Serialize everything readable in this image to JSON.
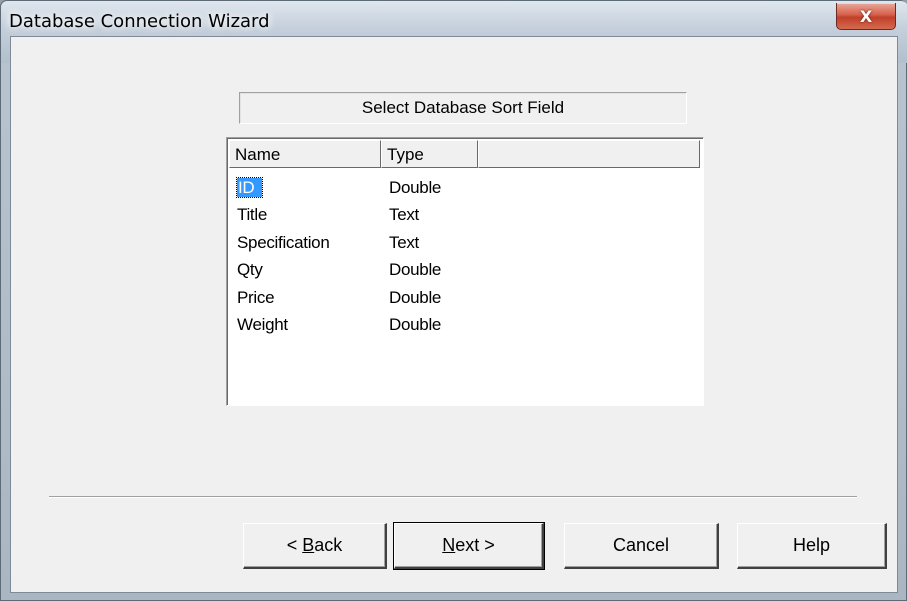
{
  "window": {
    "title": "Database Connection Wizard",
    "close_symbol": "X",
    "close_icon": "close-icon"
  },
  "panel": {
    "heading": "Select Database Sort Field"
  },
  "fields_list": {
    "columns": [
      "Name",
      "Type",
      ""
    ],
    "rows": [
      {
        "name": "ID",
        "type": "Double",
        "selected": true
      },
      {
        "name": "Title",
        "type": "Text",
        "selected": false
      },
      {
        "name": "Specification",
        "type": "Text",
        "selected": false
      },
      {
        "name": "Qty",
        "type": "Double",
        "selected": false
      },
      {
        "name": "Price",
        "type": "Double",
        "selected": false
      },
      {
        "name": "Weight",
        "type": "Double",
        "selected": false
      }
    ]
  },
  "buttons": {
    "back_prefix": "< ",
    "back_mnemonic": "B",
    "back_rest": "ack",
    "next_mnemonic": "N",
    "next_rest": "ext >",
    "cancel": "Cancel",
    "help": "Help"
  },
  "colors": {
    "selection": "#3399ff",
    "close_button": "#c0402b",
    "client_background": "#f0f0f0"
  }
}
